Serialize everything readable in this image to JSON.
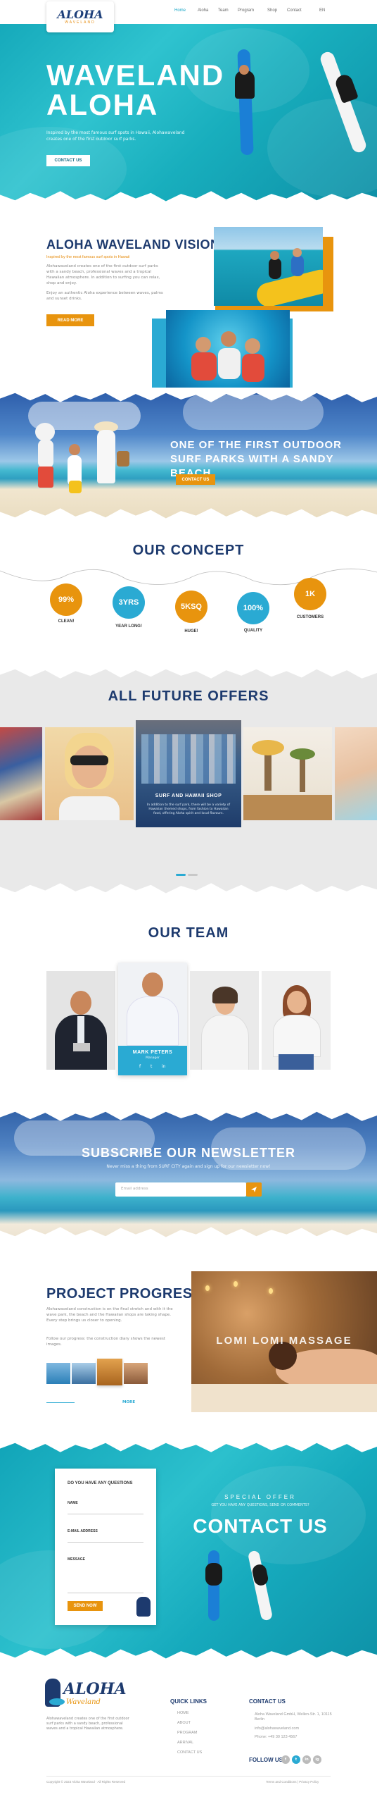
{
  "nav": {
    "logo_main": "ALOHA",
    "logo_sub": "WAVELAND",
    "items": [
      "Home",
      "Aloha",
      "Team",
      "Program",
      "Shop",
      "Contact",
      "EN"
    ]
  },
  "hero": {
    "title_line1": "WAVELAND",
    "title_line2": "ALOHA",
    "subtitle": "Inspired by the most famous surf spots in Hawaii, Alohawaveland creates one of the first outdoor surf parks.",
    "button": "CONTACT US"
  },
  "vision": {
    "title": "ALOHA WAVELAND VISION",
    "subtitle": "Inspired by the most famous surf spots in Hawaii",
    "paragraph1": "Alohawaveland creates one of the first outdoor surf parks with a sandy beach, professional waves and a tropical Hawaiian atmosphere. In addition to surfing you can relax, shop and enjoy.",
    "paragraph2": "Enjoy an authentic Aloha experience between waves, palms and sunset drinks.",
    "button": "READ MORE"
  },
  "beach_banner": {
    "line1": "ONE OF THE FIRST OUTDOOR",
    "line2": "SURF PARKS WITH A SANDY BEACH",
    "button": "CONTACT US"
  },
  "concept": {
    "title": "OUR CONCEPT",
    "stats": [
      {
        "value": "99%",
        "label": "CLEAN!",
        "color": "#e8940e"
      },
      {
        "value": "3YRS",
        "label": "YEAR LONG!",
        "color": "#2aaad3"
      },
      {
        "value": "5KSQ",
        "label": "HUGE!",
        "color": "#e8940e"
      },
      {
        "value": "100%",
        "label": "QUALITY",
        "color": "#2aaad3"
      },
      {
        "value": "1K",
        "label": "CUSTOMERS",
        "color": "#e8940e"
      }
    ]
  },
  "offers": {
    "title": "ALL FUTURE OFFERS",
    "featured_title": "SURF AND HAWAII SHOP",
    "featured_text": "In addition to the surf park, there will be a variety of Hawaiian themed shops, from fashion to Hawaiian food, offering Aloha spirit and local flavours."
  },
  "team": {
    "title": "OUR TEAM",
    "featured_name": "MARK PETERS",
    "featured_role": "Manager"
  },
  "newsletter": {
    "title": "SUBSCRIBE OUR NEWSLETTER",
    "subtitle": "Never miss a thing from SURF CITY again and sign up for our newsletter now!",
    "placeholder": "Email address",
    "send_icon": "paper-plane-icon"
  },
  "project": {
    "title": "PROJECT PROGRESS",
    "paragraph1": "Alohawaveland construction is on the final stretch and with it the wave park, the beach and the Hawaiian shops are taking shape. Every step brings us closer to opening.",
    "paragraph2": "Follow our progress: the construction diary shows the newest images.",
    "massage_label": "LOMI LOMI MASSAGE",
    "more_link": "MORE"
  },
  "contact": {
    "form_title": "DO YOU HAVE ANY QUESTIONS",
    "name_label": "NAME",
    "email_label": "E-MAIL ADDRESS",
    "message_label": "MESSAGE",
    "submit": "SEND NOW",
    "offer_kicker": "SPECIAL OFFER",
    "offer_sub": "GET YOU HAVE ANY QUESTIONS, SEND OR COMMENTS?",
    "big_title": "CONTACT US"
  },
  "footer": {
    "logo_main": "ALOHA",
    "logo_sub": "Waveland",
    "about": "Alohawaveland creates one of the first outdoor surf parks with a sandy beach, professional waves and a tropical Hawaiian atmosphere.",
    "quick_links_title": "QUICK LINKS",
    "quick_links": [
      "HOME",
      "ABOUT",
      "PROGRAM",
      "ARRIVAL",
      "CONTACT US"
    ],
    "contact_title": "CONTACT US",
    "address": "Aloha Waveland GmbH, Wellen-Str. 1, 10115 Berlin",
    "email": "info@alohawaveland.com",
    "phone": "Phone: +49 30 123 4567",
    "follow_label": "FOLLOW US",
    "social": [
      "f",
      "t",
      "in",
      "ig"
    ],
    "copyright": "Copyright © 2023 Aloha Waveland · All Rights Reserved",
    "legal": "Terms and Conditions  |  Privacy Policy"
  },
  "colors": {
    "accent_orange": "#e8940e",
    "accent_blue": "#2aaad3",
    "navy": "#1d3a6e",
    "aqua": "#18aebd"
  }
}
